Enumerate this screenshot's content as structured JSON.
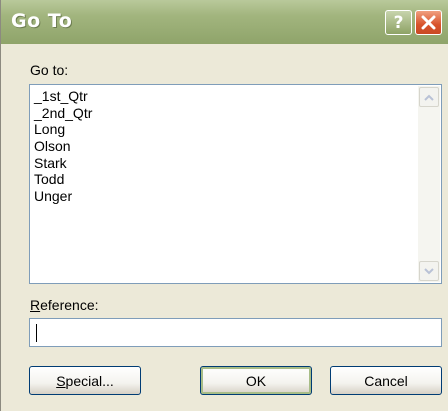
{
  "window": {
    "title": "Go To",
    "help_glyph": "?",
    "close_glyph": "X"
  },
  "goto": {
    "label": "Go to:",
    "items": [
      "_1st_Qtr",
      "_2nd_Qtr",
      "Long",
      "Olson",
      "Stark",
      "Todd",
      "Unger"
    ]
  },
  "reference": {
    "label_accel": "R",
    "label_rest": "eference:",
    "value": ""
  },
  "buttons": {
    "special_accel": "S",
    "special_rest": "pecial...",
    "ok": "OK",
    "cancel": "Cancel"
  },
  "colors": {
    "titlebar": "#a2b57e",
    "dialog_bg": "#ece9d8",
    "close_red": "#d8532c",
    "field_border": "#7f9db9"
  }
}
